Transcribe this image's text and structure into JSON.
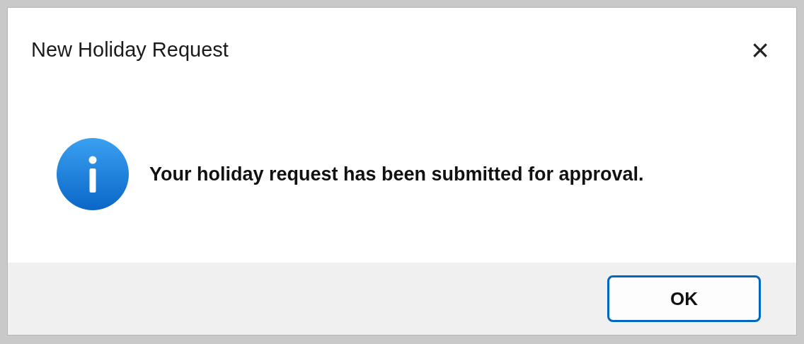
{
  "window": {
    "title": "New Holiday Request",
    "close": "×"
  },
  "message": {
    "text": "Your holiday request has been submitted for approval."
  },
  "buttons": [
    {
      "label": "OK",
      "default": true
    }
  ]
}
